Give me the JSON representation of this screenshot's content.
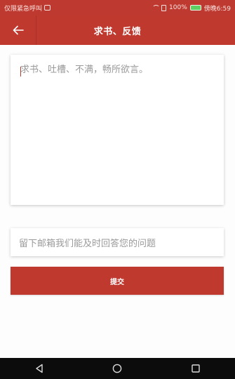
{
  "status_bar": {
    "left_text": "仅限紧急呼叫",
    "battery_text": "100%",
    "time_text": "傍晚6:59"
  },
  "app_bar": {
    "title": "求书、反馈",
    "back_icon": "arrow-left-icon"
  },
  "feedback": {
    "placeholder": "求书、吐槽、不满，畅所欲言。",
    "value": ""
  },
  "email": {
    "placeholder": "留下邮箱我们能及时回答您的问题",
    "value": ""
  },
  "submit": {
    "label": "提交"
  },
  "nav_bar": {
    "back_icon": "triangle-back-icon",
    "home_icon": "circle-home-icon",
    "recents_icon": "square-recents-icon"
  },
  "colors": {
    "primary": "#c0392f",
    "status_bar": "#be3a30",
    "placeholder_text": "#9a9a9a",
    "nav_bar": "#0c0c0c"
  }
}
